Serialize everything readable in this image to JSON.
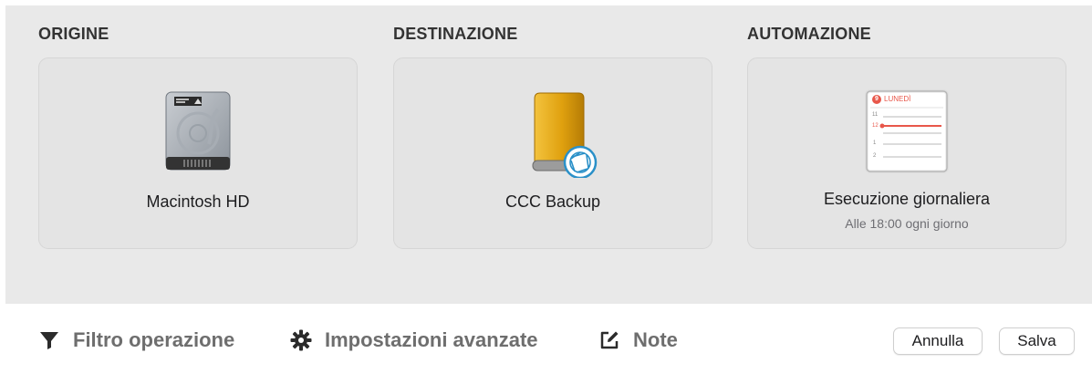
{
  "sections": {
    "source": {
      "title": "ORIGINE",
      "label": "Macintosh HD",
      "icon": "internal-disk-icon"
    },
    "destination": {
      "title": "DESTINAZIONE",
      "label": "CCC Backup",
      "icon": "external-disk-icon"
    },
    "automation": {
      "title": "AUTOMAZIONE",
      "label": "Esecuzione giornaliera",
      "sublabel": "Alle 18:00 ogni giorno",
      "icon": "calendar-icon",
      "calendar_day": "LUNEDÌ",
      "calendar_badge": "9",
      "calendar_hours": [
        "11",
        "12",
        "1",
        "2"
      ]
    }
  },
  "toolbar": {
    "filter_label": "Filtro operazione",
    "advanced_label": "Impostazioni avanzate",
    "notes_label": "Note",
    "cancel_label": "Annulla",
    "save_label": "Salva"
  },
  "colors": {
    "panel_bg": "#e9e9e9",
    "card_bg": "#e4e4e4",
    "external_disk": "#e0a10f",
    "accent_badge": "#2a90c8",
    "calendar_red": "#e8574a"
  }
}
